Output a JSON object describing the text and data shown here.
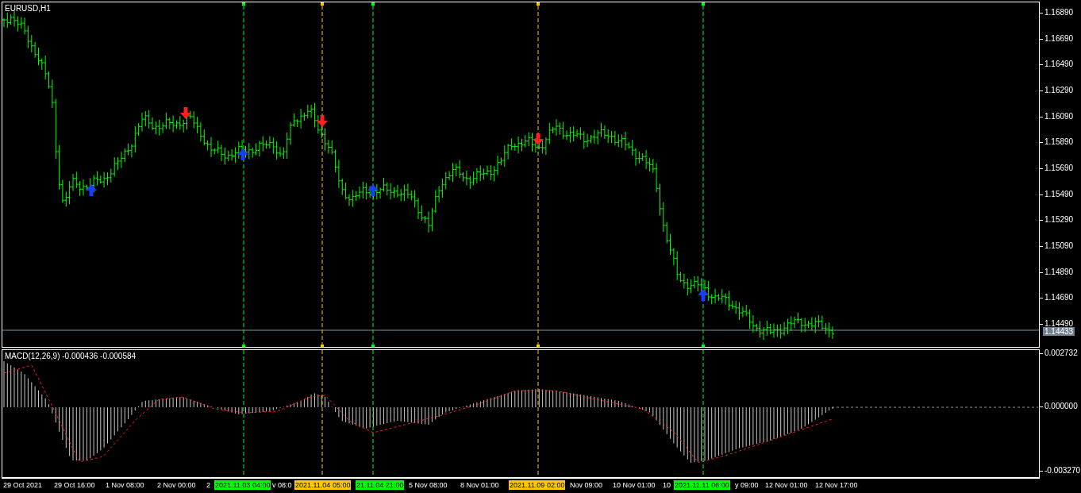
{
  "window": {
    "title": "EURUSD,H1"
  },
  "price_axis": {
    "ticks": [
      "1.16890",
      "1.16690",
      "1.16490",
      "1.16290",
      "1.16090",
      "1.15890",
      "1.15690",
      "1.15490",
      "1.15290",
      "1.15090",
      "1.14890",
      "1.14690",
      "1.14490"
    ],
    "current_price": "1.14433"
  },
  "vertical_lines": [
    {
      "label": "2021.11.03 04:00",
      "color": "#00ff00"
    },
    {
      "label": "2021.11.04 05:00",
      "color": "#ffc800"
    },
    {
      "label": "21.11.04 21:00",
      "color": "#00ff00"
    },
    {
      "label": "2021.11.09 02:00",
      "color": "#ffc800"
    },
    {
      "label": "2021.11.11 06:00",
      "color": "#00ff00"
    }
  ],
  "signals": [
    {
      "kind": "buy"
    },
    {
      "kind": "sell"
    },
    {
      "kind": "buy"
    },
    {
      "kind": "sell"
    },
    {
      "kind": "buy"
    },
    {
      "kind": "sell"
    },
    {
      "kind": "buy"
    }
  ],
  "indicator": {
    "title": "MACD(12,26,9) -0.000436 -0.000584",
    "ticks": [
      "0.002732",
      "0.000000",
      "-0.003270"
    ]
  },
  "time_axis": {
    "labels": [
      "29 Oct 2021",
      "29 Oct 16:00",
      "1 Nov 08:00",
      "2 Nov 00:00",
      "2",
      "v 08:0",
      "5 Nov 08:00",
      "8 Nov 01:00",
      "Nov 09:00",
      "10 Nov 01:00",
      "10",
      "y 09:00",
      "12 Nov 01:00",
      "12 Nov 17:00"
    ]
  }
}
